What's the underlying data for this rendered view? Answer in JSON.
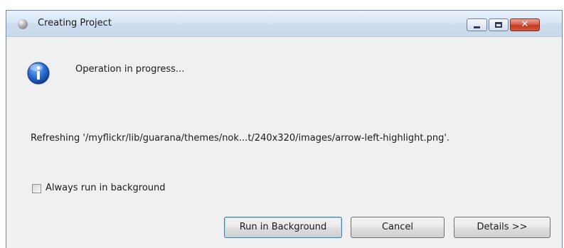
{
  "window": {
    "title": "Creating Project",
    "controls": {
      "minimize": "minimize",
      "maximize": "maximize",
      "close": "close"
    }
  },
  "dialog": {
    "icon": "info-icon",
    "message": "Operation in progress...",
    "status": "Refreshing '/myflickr/lib/guarana/themes/nok...t/240x320/images/arrow-left-highlight.png'.",
    "checkbox": {
      "label": "Always run in background",
      "checked": false
    }
  },
  "buttons": {
    "run_in_background": "Run in Background",
    "cancel": "Cancel",
    "details": "Details >>"
  },
  "colors": {
    "dialog_background": "#f0f0f0",
    "titlebar": "#d9e6f5",
    "close_button": "#c3381f",
    "info_icon": "#1a5fb4",
    "default_button_border": "#3c7fb1"
  }
}
